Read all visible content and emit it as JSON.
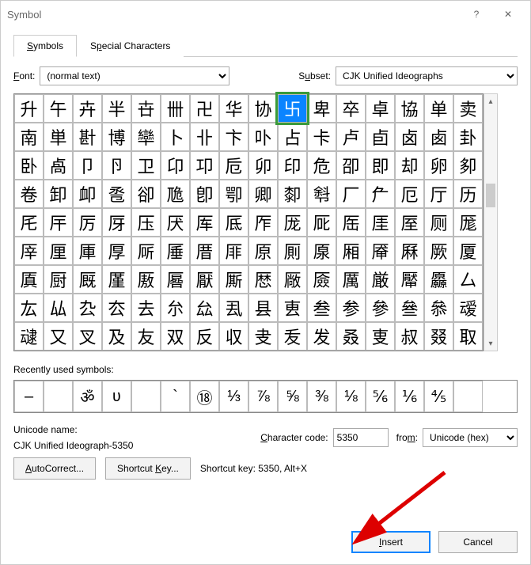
{
  "window": {
    "title": "Symbol"
  },
  "tabs": {
    "symbols": "Symbols",
    "special": "Special Characters"
  },
  "font": {
    "label": "Font:",
    "value": "(normal text)"
  },
  "subset": {
    "label": "Subset:",
    "value": "CJK Unified Ideographs"
  },
  "grid": {
    "rows": [
      [
        "升",
        "午",
        "卉",
        "半",
        "卋",
        "卌",
        "卍",
        "华",
        "协",
        "卐",
        "卑",
        "卒",
        "卓",
        "協",
        "单",
        "卖"
      ],
      [
        "南",
        "単",
        "卙",
        "博",
        "卛",
        "卜",
        "卝",
        "卞",
        "卟",
        "占",
        "卡",
        "卢",
        "卣",
        "卤",
        "卥",
        "卦"
      ],
      [
        "卧",
        "卨",
        "卩",
        "卪",
        "卫",
        "卬",
        "卭",
        "卮",
        "卯",
        "印",
        "危",
        "卲",
        "即",
        "却",
        "卵",
        "卶"
      ],
      [
        "卷",
        "卸",
        "卹",
        "卺",
        "卻",
        "卼",
        "卽",
        "卾",
        "卿",
        "厀",
        "厁",
        "厂",
        "厃",
        "厄",
        "厅",
        "历"
      ],
      [
        "厇",
        "厈",
        "厉",
        "厊",
        "压",
        "厌",
        "厍",
        "厎",
        "厏",
        "厐",
        "厑",
        "厒",
        "厓",
        "厔",
        "厕",
        "厖"
      ],
      [
        "厗",
        "厘",
        "厙",
        "厚",
        "厛",
        "厜",
        "厝",
        "厞",
        "原",
        "厠",
        "厡",
        "厢",
        "厣",
        "厤",
        "厥",
        "厦"
      ],
      [
        "厧",
        "厨",
        "厩",
        "厪",
        "厫",
        "厬",
        "厭",
        "厮",
        "厯",
        "厰",
        "厱",
        "厲",
        "厳",
        "厴",
        "厵",
        "厶"
      ],
      [
        "厷",
        "厸",
        "厹",
        "厺",
        "去",
        "厼",
        "厽",
        "厾",
        "县",
        "叀",
        "叁",
        "参",
        "參",
        "叄",
        "叅",
        "叆"
      ],
      [
        "叇",
        "又",
        "叉",
        "及",
        "友",
        "双",
        "反",
        "収",
        "叏",
        "叐",
        "发",
        "叒",
        "叓",
        "叔",
        "叕",
        "取"
      ]
    ],
    "selected": {
      "row": 0,
      "col": 9
    }
  },
  "recent": {
    "label": "Recently used symbols:",
    "items": [
      "–",
      "",
      "ॐ",
      "ʋ",
      "",
      "`",
      "⑱",
      "⅓",
      "⅞",
      "⅝",
      "⅜",
      "⅛",
      "⅚",
      "⅙",
      "⅘",
      ""
    ]
  },
  "unicode": {
    "name_label": "Unicode name:",
    "name_value": "CJK Unified Ideograph-5350",
    "code_label": "Character code:",
    "code_value": "5350",
    "from_label": "from:",
    "from_value": "Unicode (hex)"
  },
  "buttons": {
    "autocorrect": "AutoCorrect...",
    "shortcut": "Shortcut Key...",
    "shortcut_text": "Shortcut key: 5350, Alt+X",
    "insert": "Insert",
    "cancel": "Cancel"
  }
}
